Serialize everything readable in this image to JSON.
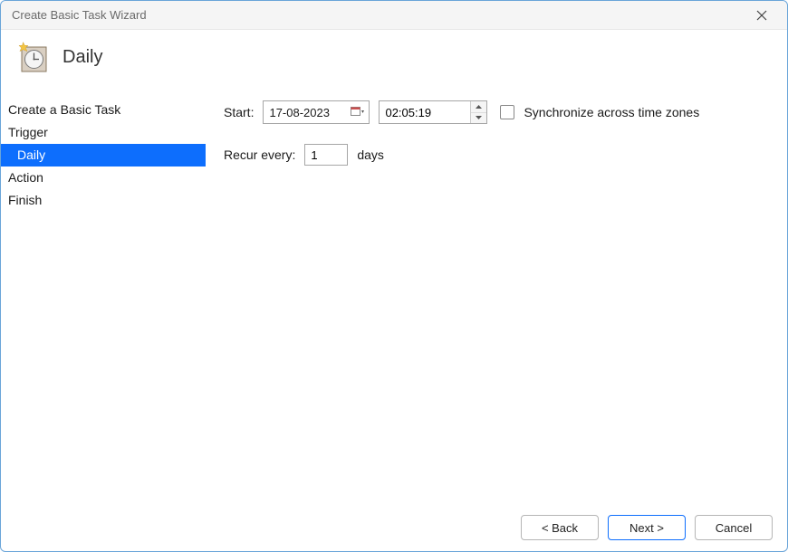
{
  "window": {
    "title": "Create Basic Task Wizard"
  },
  "header": {
    "title": "Daily"
  },
  "sidebar": {
    "items": [
      {
        "label": "Create a Basic Task",
        "selected": false,
        "indent": false
      },
      {
        "label": "Trigger",
        "selected": false,
        "indent": false
      },
      {
        "label": "Daily",
        "selected": true,
        "indent": true
      },
      {
        "label": "Action",
        "selected": false,
        "indent": false
      },
      {
        "label": "Finish",
        "selected": false,
        "indent": false
      }
    ]
  },
  "form": {
    "start_label": "Start:",
    "date_value": "17-08-2023",
    "time_value": "02:05:19",
    "sync_label": "Synchronize across time zones",
    "sync_checked": false,
    "recur_label": "Recur every:",
    "recur_value": "1",
    "recur_unit": "days"
  },
  "footer": {
    "back": "< Back",
    "next": "Next >",
    "cancel": "Cancel"
  }
}
